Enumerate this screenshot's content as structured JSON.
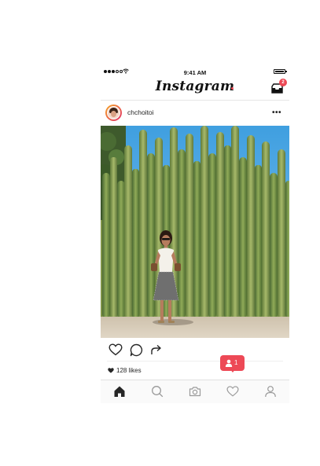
{
  "status_bar": {
    "time": "9:41 AM"
  },
  "header": {
    "logo": "Instagram",
    "inbox_badge": "2"
  },
  "post": {
    "username": "chchoitoi",
    "more_label": "•••",
    "likes": "128 likes"
  },
  "notification": {
    "count": "1"
  },
  "icons": {
    "like": "heart-icon",
    "comment": "comment-icon",
    "share": "share-icon",
    "home": "home-icon",
    "search": "search-icon",
    "camera": "camera-icon",
    "activity": "heart-icon",
    "profile": "profile-icon",
    "inbox": "inbox-icon"
  },
  "colors": {
    "accent": "#ed4956",
    "text": "#262626",
    "sky": "#4ea8e2"
  }
}
